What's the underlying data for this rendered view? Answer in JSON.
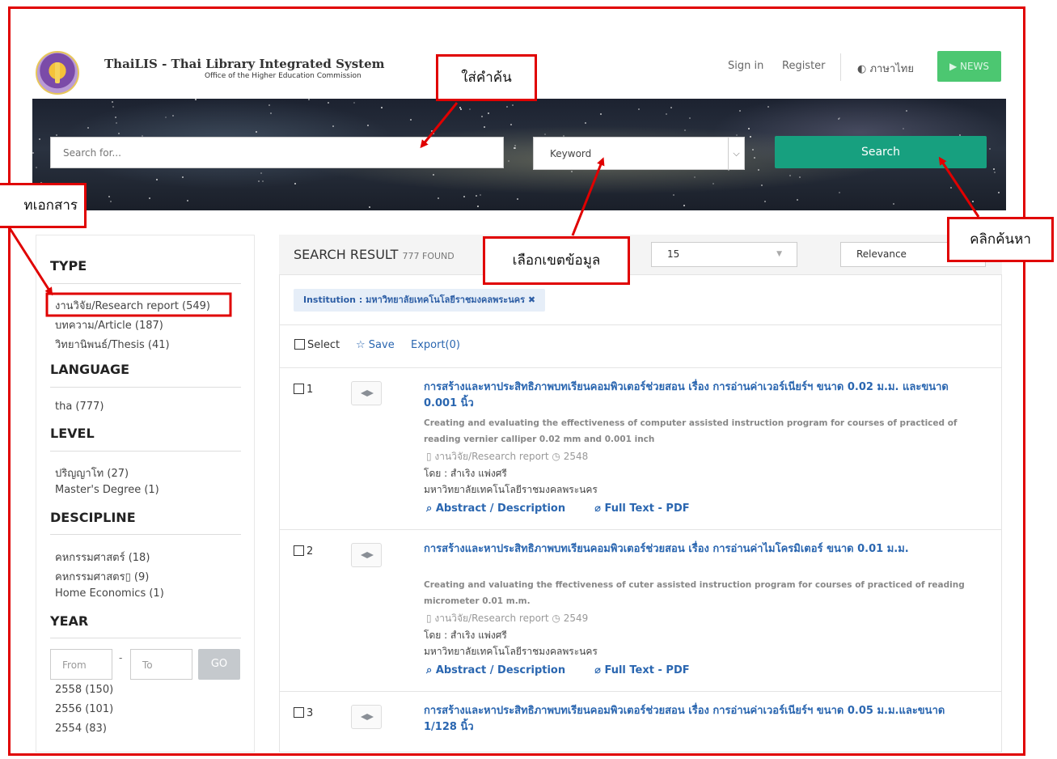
{
  "header": {
    "brand_title": "ThaiLIS - Thai Library Integrated System",
    "brand_subtitle": "Office of the Higher Education Commission",
    "sign_in": "Sign in",
    "register": "Register",
    "language": "ภาษาไทย",
    "language_icon": "globe-icon",
    "news": "NEWS",
    "news_icon": "megaphone-icon"
  },
  "search": {
    "placeholder": "Search for...",
    "scope_value": "Keyword",
    "button": "Search"
  },
  "sidebar": {
    "type_heading": "TYPE",
    "type_items": [
      "งานวิจัย/Research report (549)",
      "บทความ/Article (187)",
      "วิทยานิพนธ์/Thesis (41)"
    ],
    "language_heading": "LANGUAGE",
    "language_items": [
      "tha (777)"
    ],
    "level_heading": "LEVEL",
    "level_items": [
      "ปริญญาโท (27)",
      "Master's Degree (1)"
    ],
    "discipline_heading": "DESCIPLINE",
    "discipline_items": [
      "คหกรรมศาสตร์ (18)",
      "คหกรรมศาสตร▯ (9)",
      "Home Economics (1)"
    ],
    "year_heading": "YEAR",
    "year_from_placeholder": "From",
    "year_to_placeholder": "To",
    "year_go": "GO",
    "year_items": [
      "2558 (150)",
      "2556 (101)",
      "2554 (83)"
    ]
  },
  "results": {
    "title": "SEARCH RESULT",
    "count": "777 FOUND",
    "per_page": "15",
    "sort": "Relevance",
    "filter_chip": "Institution : มหาวิทยาลัยเทคโนโลยีราชมงคลพระนคร ✖",
    "select_label": "Select",
    "save_label": "Save",
    "export_label": "Export(0)",
    "records": [
      {
        "num": "1",
        "title": "การสร้างและหาประสิทธิภาพบทเรียนคอมพิวเตอร์ช่วยสอน เรื่อง การอ่านค่าเวอร์เนียร์ฯ ขนาด 0.02 ม.ม. และขนาด 0.001 นิ้ว",
        "title_en": "Creating and evaluating the effectiveness of computer assisted instruction program for courses of practiced of reading vernier calliper 0.02 mm and 0.001 inch",
        "type": "งานวิจัย/Research report",
        "year": "2548",
        "author": "โดย : สำเริง แพ่งศรี",
        "institution": "มหาวิทยาลัยเทคโนโลยีราชมงคลพระนคร",
        "abstract_link": "Abstract / Description",
        "fulltext_link": "Full Text - PDF"
      },
      {
        "num": "2",
        "title": "การสร้างและหาประสิทธิภาพบทเรียนคอมพิวเตอร์ช่วยสอน เรื่อง การอ่านค่าไมโครมิเตอร์ ขนาด 0.01 ม.ม.",
        "title_en": "Creating and valuating the ffectiveness of cuter assisted instruction program for courses of practiced of reading micrometer 0.01 m.m.",
        "type": "งานวิจัย/Research report",
        "year": "2549",
        "author": "โดย : สำเริง แพ่งศรี",
        "institution": "มหาวิทยาลัยเทคโนโลยีราชมงคลพระนคร",
        "abstract_link": "Abstract / Description",
        "fulltext_link": "Full Text - PDF"
      },
      {
        "num": "3",
        "title": "การสร้างและหาประสิทธิภาพบทเรียนคอมพิวเตอร์ช่วยสอน เรื่อง การอ่านค่าเวอร์เนียร์ฯ ขนาด 0.05 ม.ม.และขนาด 1/128 นิ้ว"
      }
    ]
  },
  "annotations": {
    "enter_keyword": "ใส่คำค้น",
    "doc_type": "ทเอกสาร",
    "choose_scope": "เลือกเขตข้อมูล",
    "click_search": "คลิกค้นหา",
    "color": "#e00000"
  }
}
